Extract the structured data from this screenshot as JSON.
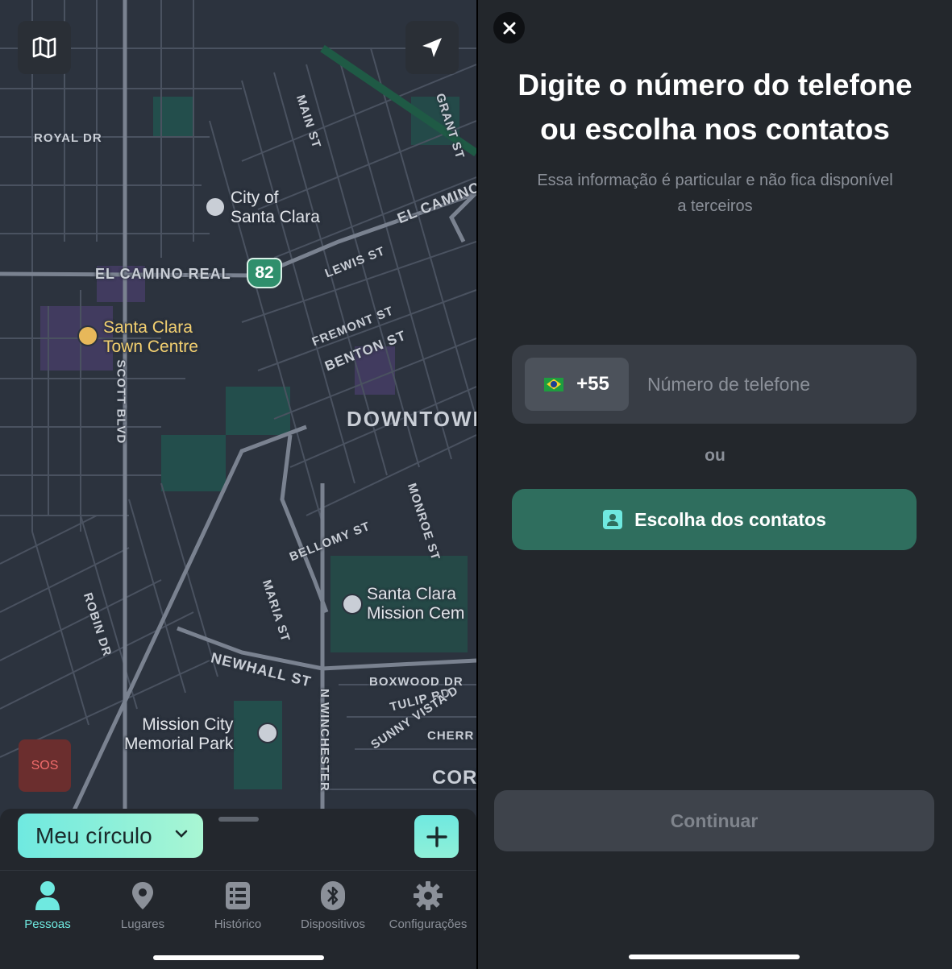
{
  "map": {
    "streets": [
      "ROYAL DR",
      "MAIN ST",
      "GRANT ST",
      "EL CAMINO",
      "LEWIS ST",
      "EL CAMINO REAL",
      "FREMONT ST",
      "BENTON ST",
      "SCOTT BLVD",
      "DOWNTOWN",
      "BELLOMY ST",
      "MONROE ST",
      "MARIA ST",
      "ROBIN DR",
      "NEWHALL ST",
      "BOXWOOD DR",
      "TULIP RD",
      "SUNNY VISTA D",
      "CHERR",
      "N WINCHESTER",
      "CORY"
    ],
    "shield": "82",
    "pois": {
      "city": [
        "City of",
        "Santa Clara"
      ],
      "town": [
        "Santa Clara",
        "Town Centre"
      ],
      "mission": [
        "Santa Clara",
        "Mission Cem"
      ],
      "memorial": [
        "Mission City",
        "Memorial Park"
      ]
    },
    "sos_label": "SOS"
  },
  "sheet": {
    "circle_label": "Meu círculo"
  },
  "tabs": [
    {
      "label": "Pessoas",
      "icon": "person-icon",
      "active": true
    },
    {
      "label": "Lugares",
      "icon": "location-pin-icon",
      "active": false
    },
    {
      "label": "Histórico",
      "icon": "list-icon",
      "active": false
    },
    {
      "label": "Dispositivos",
      "icon": "bluetooth-icon",
      "active": false
    },
    {
      "label": "Configurações",
      "icon": "gear-icon",
      "active": false
    }
  ],
  "dialog": {
    "title_line1": "Digite o número do telefone",
    "title_line2": "ou escolha nos contatos",
    "subtitle_line1": "Essa informação é particular e não fica disponível",
    "subtitle_line2": "a terceiros",
    "country_code": "+55",
    "phone_placeholder": "Número de telefone",
    "or_label": "ou",
    "contacts_label": "Escolha dos contatos",
    "continue_label": "Continuar"
  },
  "colors": {
    "accent": "#6fe9e0",
    "contacts_button": "#2f6e5e",
    "sos": "#6b2e2e"
  }
}
